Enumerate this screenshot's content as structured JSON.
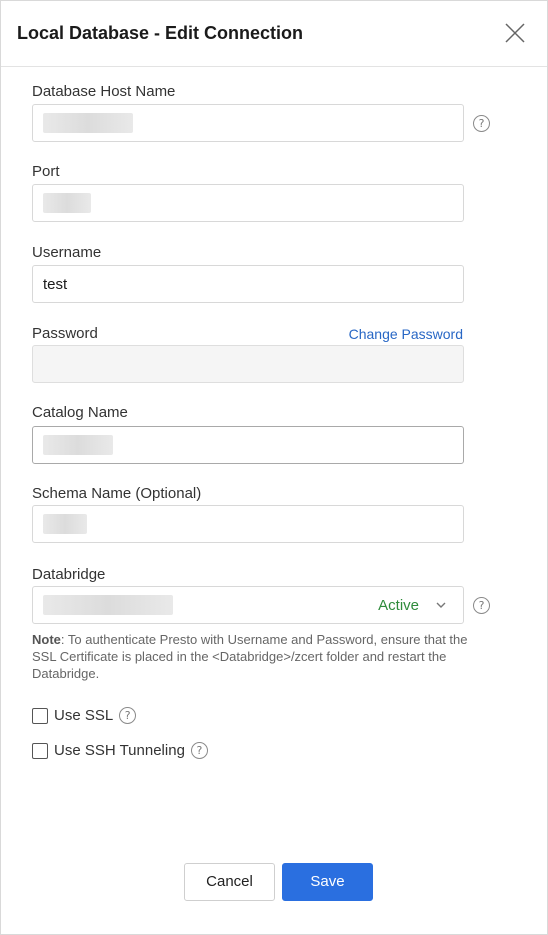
{
  "dialog": {
    "title": "Local Database - Edit Connection"
  },
  "fields": {
    "host": {
      "label": "Database Host Name",
      "value": ""
    },
    "port": {
      "label": "Port",
      "value": ""
    },
    "username": {
      "label": "Username",
      "value": "test"
    },
    "password": {
      "label": "Password",
      "value": "",
      "change_link": "Change Password"
    },
    "catalog": {
      "label": "Catalog Name",
      "value": ""
    },
    "schema": {
      "label": "Schema Name (Optional)",
      "value": ""
    },
    "databridge": {
      "label": "Databridge",
      "value": "",
      "status": "Active"
    }
  },
  "note": {
    "prefix": "Note",
    "text": ": To authenticate Presto with Username and Password, ensure that the SSL Certificate is placed in the <Databridge>/zcert folder and restart the Databridge."
  },
  "options": {
    "use_ssl": {
      "label": "Use SSL",
      "checked": false
    },
    "use_ssh": {
      "label": "Use SSH Tunneling",
      "checked": false
    }
  },
  "buttons": {
    "cancel": "Cancel",
    "save": "Save"
  },
  "help_glyph": "?",
  "colors": {
    "primary": "#2a6fe0",
    "link": "#2867c5",
    "status_active": "#2e8b3b"
  }
}
